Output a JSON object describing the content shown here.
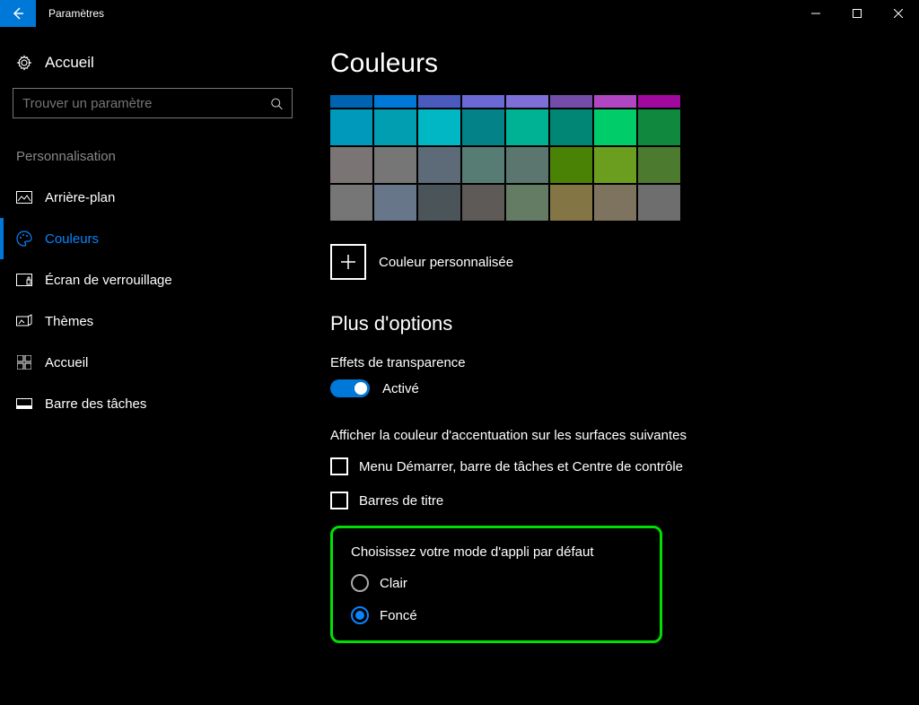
{
  "titlebar": {
    "title": "Paramètres"
  },
  "sidebar": {
    "home": "Accueil",
    "search_placeholder": "Trouver un paramètre",
    "category": "Personnalisation",
    "items": [
      {
        "label": "Arrière-plan"
      },
      {
        "label": "Couleurs"
      },
      {
        "label": "Écran de verrouillage"
      },
      {
        "label": "Thèmes"
      },
      {
        "label": "Accueil"
      },
      {
        "label": "Barre des tâches"
      }
    ]
  },
  "main": {
    "title": "Couleurs",
    "swatches": [
      [
        "#0063b1",
        "#0078d7",
        "#4a5bbd",
        "#6b69d6",
        "#7e6fd8",
        "#744da9",
        "#b146c2",
        "#a0089e"
      ],
      [
        "#0099bc",
        "#009eb0",
        "#00b7c3",
        "#038387",
        "#00b294",
        "#018574",
        "#00cc6a",
        "#10893e"
      ],
      [
        "#7a7574",
        "#767676",
        "#5d6b78",
        "#567c73",
        "#5a766f",
        "#498205",
        "#6b9e1f",
        "#4c7a2e"
      ],
      [
        "#767676",
        "#68768a",
        "#4a5459",
        "#5d5a58",
        "#647c64",
        "#847545",
        "#7e735f",
        "#6e6e6e"
      ]
    ],
    "custom_color_label": "Couleur personnalisée",
    "more_options": "Plus d'options",
    "transparency_label": "Effets de transparence",
    "transparency_state": "Activé",
    "accent_label": "Afficher la couleur d'accentuation sur les surfaces suivantes",
    "checkbox1": "Menu Démarrer, barre de tâches et Centre de contrôle",
    "checkbox2": "Barres de titre",
    "mode_label": "Choisissez votre mode d'appli par défaut",
    "mode_light": "Clair",
    "mode_dark": "Foncé"
  }
}
